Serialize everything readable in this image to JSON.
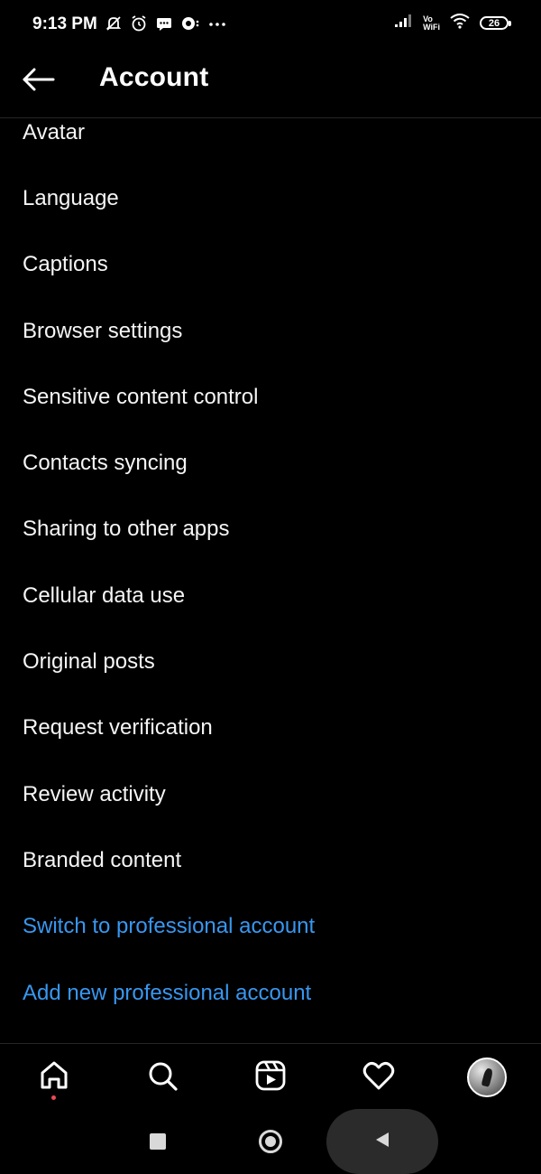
{
  "status_bar": {
    "time": "9:13 PM",
    "vo": "Vo",
    "wifi_label": "WiFi",
    "battery": "26",
    "icons": [
      "muted-bell-icon",
      "alarm-icon",
      "message-icon",
      "chat-bubble-icon",
      "more-dots-icon",
      "signal-icon",
      "vowifi-icon",
      "wifi-icon",
      "battery-icon"
    ]
  },
  "header": {
    "title": "Account",
    "back_icon": "arrow-left-icon"
  },
  "menu": {
    "items": [
      {
        "label": "Avatar"
      },
      {
        "label": "Language"
      },
      {
        "label": "Captions"
      },
      {
        "label": "Browser settings"
      },
      {
        "label": "Sensitive content control"
      },
      {
        "label": "Contacts syncing"
      },
      {
        "label": "Sharing to other apps"
      },
      {
        "label": "Cellular data use"
      },
      {
        "label": "Original posts"
      },
      {
        "label": "Request verification"
      },
      {
        "label": "Review activity"
      },
      {
        "label": "Branded content"
      },
      {
        "label": "Switch to professional account"
      },
      {
        "label": "Add new professional account"
      }
    ],
    "link_color": "#3897f0"
  },
  "bottom_nav": {
    "items": [
      "home-icon",
      "search-icon",
      "reels-icon",
      "heart-icon",
      "profile-avatar"
    ],
    "notification_dot_color": "#ed4956"
  },
  "system_nav": {
    "items": [
      "recent-apps-button",
      "home-button",
      "back-button"
    ]
  }
}
